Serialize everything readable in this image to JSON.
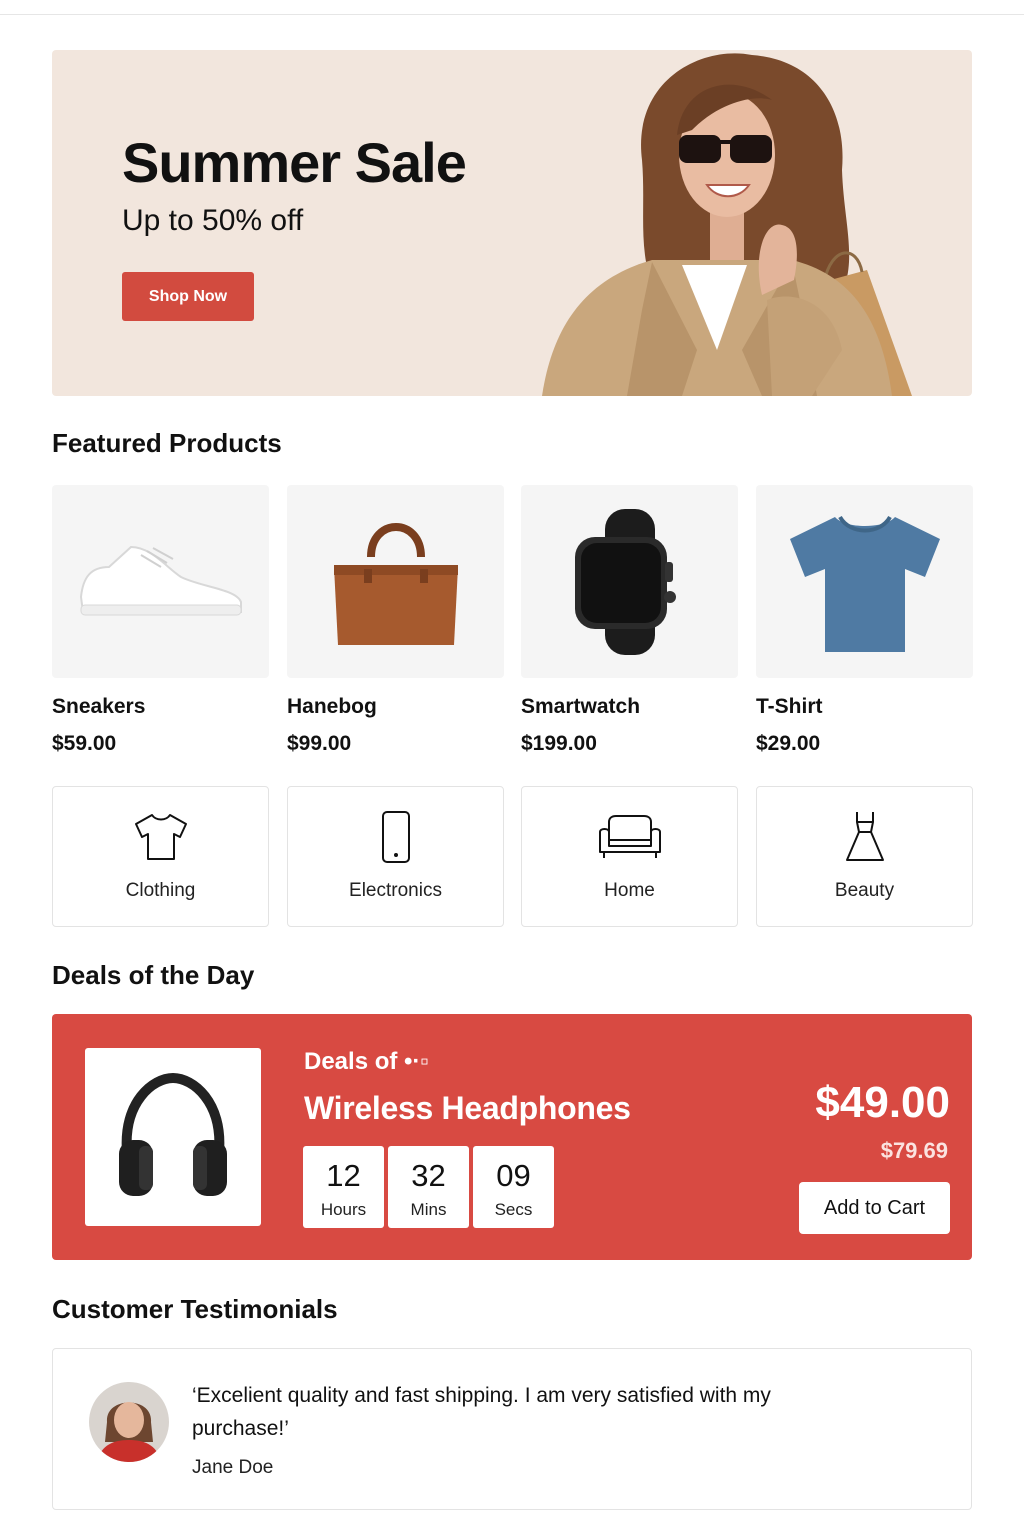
{
  "hero": {
    "title": "Summer Sale",
    "subtitle": "Up to 50% off",
    "cta_label": "Shop Now"
  },
  "featured": {
    "title": "Featured Products",
    "products": [
      {
        "name": "Sneakers",
        "price": "$59.00",
        "icon": "sneaker-icon"
      },
      {
        "name": "Hanebog",
        "price": "$99.00",
        "icon": "handbag-icon"
      },
      {
        "name": "Smartwatch",
        "price": "$199.00",
        "icon": "smartwatch-icon"
      },
      {
        "name": "T-Shirt",
        "price": "$29.00",
        "icon": "tshirt-icon"
      }
    ]
  },
  "categories": [
    {
      "label": "Clothing",
      "icon": "shirt-outline-icon"
    },
    {
      "label": "Electronics",
      "icon": "phone-outline-icon"
    },
    {
      "label": "Home",
      "icon": "sofa-outline-icon"
    },
    {
      "label": "Beauty",
      "icon": "dress-outline-icon"
    }
  ],
  "deals": {
    "title": "Deals of the Day",
    "kicker": "Deals of •·▫",
    "product_name": "Wireless Headphones",
    "timer": [
      {
        "value": "12",
        "unit": "Hours"
      },
      {
        "value": "32",
        "unit": "Mins"
      },
      {
        "value": "09",
        "unit": "Secs"
      }
    ],
    "price": "$49.00",
    "old_price": "$79.69",
    "cart_label": "Add to Cart"
  },
  "testimonials": {
    "title": "Customer Testimonials",
    "quote": "‘Excelient quality and fast shipping. I am very satisfied with my purchase!’",
    "author": "Jane Doe"
  },
  "colors": {
    "accent": "#d84a42",
    "hero_bg": "#f2e6dd",
    "card_bg": "#f5f5f5"
  }
}
